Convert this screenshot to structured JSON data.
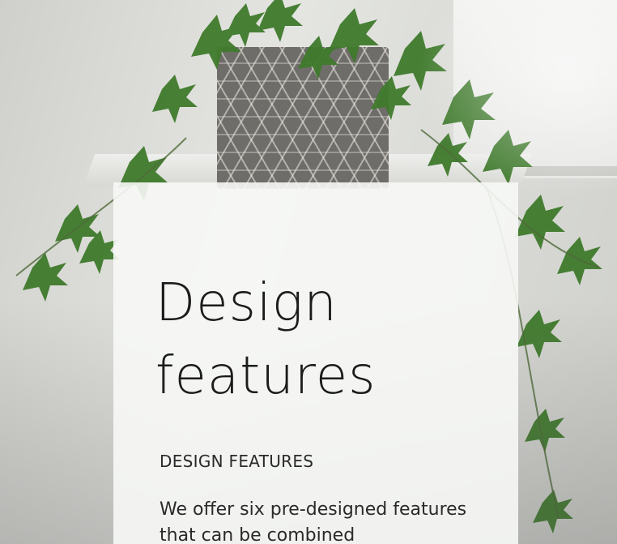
{
  "hero": {
    "image_subject": "plant-in-geometric-pot-photo"
  },
  "card": {
    "title_line1": "Design",
    "title_line2": "features",
    "eyebrow": "DESIGN FEATURES",
    "body": "We offer six pre-designed features that can be combined"
  },
  "colors": {
    "card_background": "#f7f8f6",
    "text": "#1c1c1c",
    "foliage": "#3f7a2c"
  }
}
